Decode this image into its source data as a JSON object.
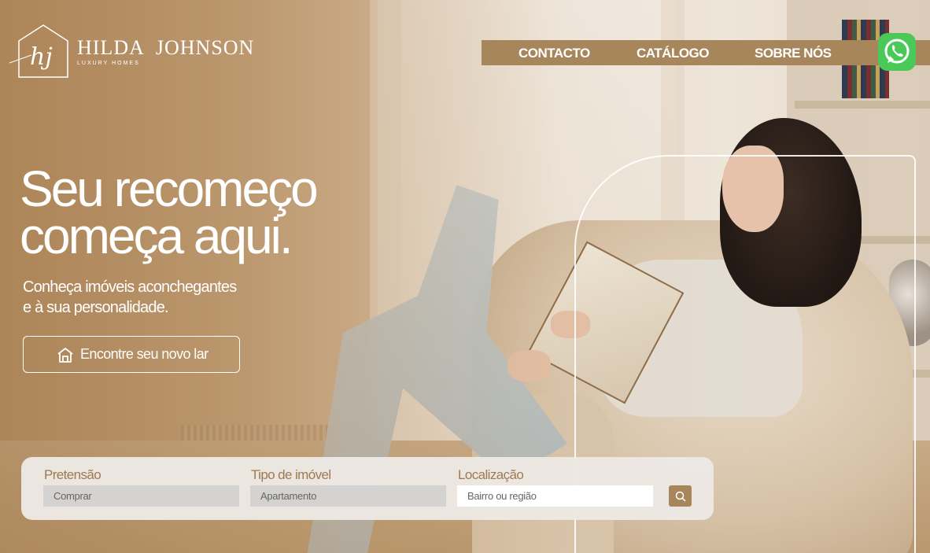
{
  "brand": {
    "monogram": "hj",
    "name_first": "HILDA",
    "name_last": "JOHNSON",
    "tagline": "LUXURY HOMES"
  },
  "nav": {
    "items": [
      {
        "label": "CONTACTO"
      },
      {
        "label": "CATÁLOGO"
      },
      {
        "label": "SOBRE NÓS"
      }
    ]
  },
  "whatsapp": {
    "icon": "whatsapp-icon"
  },
  "hero": {
    "headline_line1": "Seu recomeço",
    "headline_line2": "começa aqui.",
    "subtitle_line1": "Conheça imóveis aconchegantes",
    "subtitle_line2": "e à sua personalidade.",
    "cta_label": "Encontre seu novo lar",
    "cta_icon": "home-icon"
  },
  "search": {
    "fields": [
      {
        "label": "Pretensão",
        "value": "Comprar"
      },
      {
        "label": "Tipo de imóvel",
        "value": "Apartamento"
      },
      {
        "label": "Localização",
        "placeholder": "Bairro ou região"
      }
    ],
    "button_icon": "search-icon"
  },
  "colors": {
    "accent": "#a8865c",
    "label": "#9e7a50",
    "whatsapp": "#4ac959"
  }
}
